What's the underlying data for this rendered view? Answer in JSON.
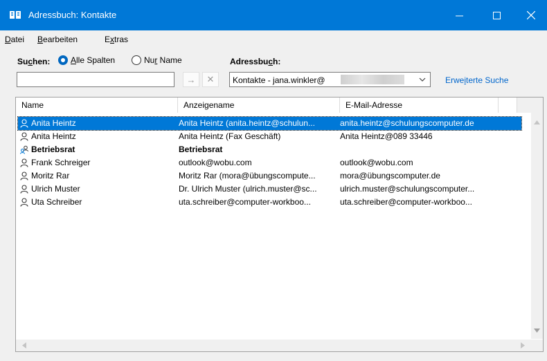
{
  "window": {
    "title": "Adressbuch: Kontakte",
    "buttons": [
      "minimize-icon",
      "maximize-icon",
      "close-icon"
    ]
  },
  "menu": {
    "items": [
      {
        "pre": "",
        "key": "D",
        "post": "atei"
      },
      {
        "pre": "",
        "key": "B",
        "post": "earbeiten"
      },
      {
        "pre": "E",
        "key": "x",
        "post": "tras"
      }
    ]
  },
  "search": {
    "label_pre": "Su",
    "label_key": "c",
    "label_post": "hen:",
    "option_all_key": "A",
    "option_all_rest": "lle Spalten",
    "option_name_pre": "Nu",
    "option_name_key": "r",
    "option_name_post": " Name",
    "selected": "Alle Spalten",
    "value": "",
    "go_icon": "arrow-right-icon",
    "clear_icon": "x-icon"
  },
  "addressbook": {
    "label_pre": "Adressbu",
    "label_key": "c",
    "label_post": "h:",
    "value": "Kontakte - jana.winkler@",
    "advanced_pre": "Erwe",
    "advanced_key": "i",
    "advanced_post": "terte Suche"
  },
  "list": {
    "columns": [
      "Name",
      "Anzeigename",
      "E-Mail-Adresse"
    ],
    "rows": [
      {
        "name": "Anita Heintz",
        "display": "Anita Heintz (anita.heintz@schulun...",
        "email": "anita.heintz@schulungscomputer.de",
        "selected": true,
        "icon": "contact-icon",
        "bold": false
      },
      {
        "name": "Anita Heintz",
        "display": "Anita Heintz (Fax Geschäft)",
        "email": "Anita Heintz@089 33446",
        "selected": false,
        "icon": "contact-icon",
        "bold": false
      },
      {
        "name": "Betriebsrat",
        "display": "Betriebsrat",
        "email": "",
        "selected": false,
        "icon": "group-icon",
        "bold": true
      },
      {
        "name": "Frank Schreiger",
        "display": "outlook@wobu.com",
        "email": "outlook@wobu.com",
        "selected": false,
        "icon": "contact-icon",
        "bold": false
      },
      {
        "name": "Moritz Rar",
        "display": "Moritz Rar (mora@übungscompute...",
        "email": "mora@übungscomputer.de",
        "selected": false,
        "icon": "contact-icon",
        "bold": false
      },
      {
        "name": "Ulrich Muster",
        "display": "Dr. Ulrich Muster (ulrich.muster@sc...",
        "email": "ulrich.muster@schulungscomputer...",
        "selected": false,
        "icon": "contact-icon",
        "bold": false
      },
      {
        "name": "Uta Schreiber",
        "display": "uta.schreiber@computer-workboo...",
        "email": "uta.schreiber@computer-workboo...",
        "selected": false,
        "icon": "contact-icon",
        "bold": false
      }
    ]
  },
  "colors": {
    "accent": "#0078d7",
    "link": "#0066cc"
  }
}
